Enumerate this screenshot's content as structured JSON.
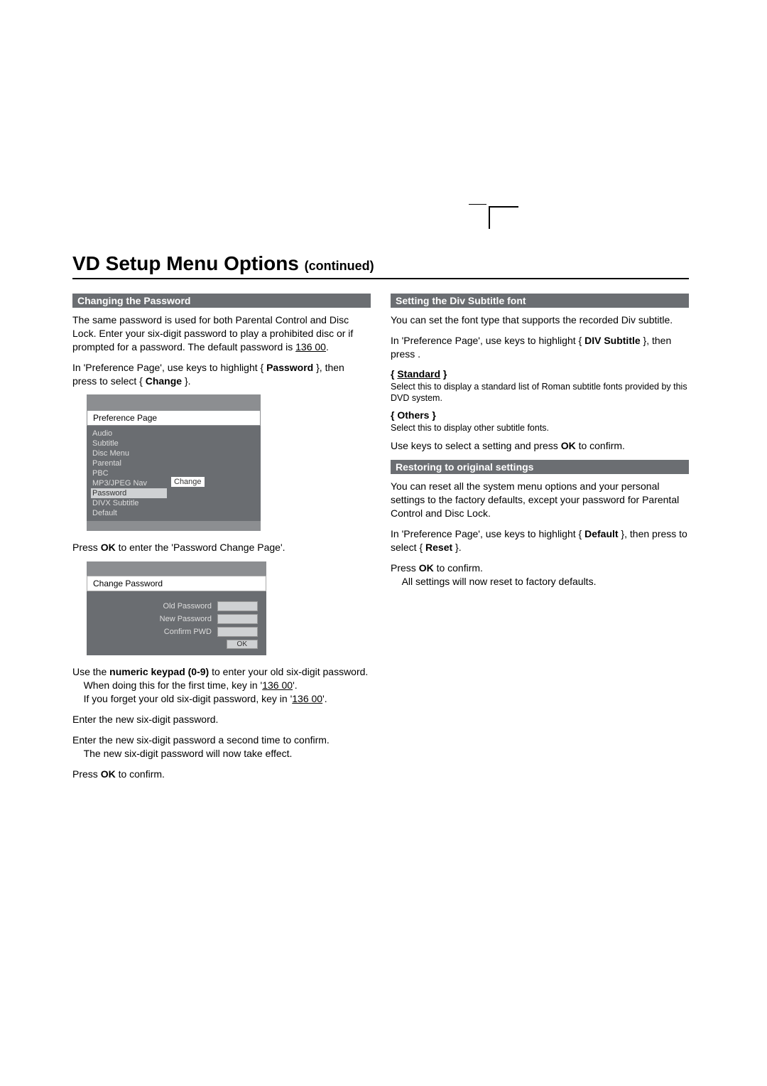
{
  "title": "VD Setup Menu Options",
  "title_suffix": "(continued)",
  "left": {
    "hdr1": "Changing the Password",
    "p1a": "The same password is used for both Parental Control and Disc Lock.  Enter your six-digit password to play a prohibited disc or if prompted for a password.  The default password is ",
    "default_pw": "136 00",
    "p1b": ".",
    "p2a": "In 'Preference Page', use ",
    "p2b": " keys to highlight { ",
    "p2c": "Password",
    "p2d": " }, then press      to select { ",
    "p2e": "Change",
    "p2f": " }.",
    "ui1": {
      "title": "Preference Page",
      "items": [
        "Audio",
        "Subtitle",
        "Disc Menu",
        "Parental",
        "PBC",
        "MP3/JPEG Nav",
        "Password",
        "DIVX Subtitle",
        "Default"
      ],
      "selected": "Password",
      "change": "Change"
    },
    "p3a": "Press ",
    "p3b": "OK",
    "p3c": " to enter the 'Password Change Page'.",
    "ui2": {
      "title": "Change Password",
      "rows": [
        "Old Password",
        "New Password",
        "Confirm PWD"
      ],
      "ok": "OK"
    },
    "p4a": "Use the ",
    "p4b": "numeric keypad (0-9)",
    "p4c": " to enter your old six-digit password.",
    "p4d": "When doing this for the first time, key in '",
    "p4e": "136 00",
    "p4f": "'.",
    "p4g": "If you forget your old six-digit password, key in '",
    "p4h": "136 00",
    "p4i": "'.",
    "p5": "Enter the new six-digit password.",
    "p6a": "Enter the new six-digit password a second time to confirm.",
    "p6b": "The new six-digit password will now take effect.",
    "p7a": "Press ",
    "p7b": "OK",
    "p7c": " to confirm."
  },
  "right": {
    "hdr1": "Setting the Div     Subtitle font",
    "p1": "You can set the font type that supports the recorded Div    subtitle.",
    "p2a": "In 'Preference Page', use ",
    "p2b": " keys to highlight { ",
    "p2c": "DIV    Subtitle",
    "p2d": " }, then press    .",
    "opt1": "Standard",
    "opt1d": "Select this to display a standard list of Roman subtitle fonts provided by this DVD system.",
    "opt2": "Others",
    "opt2d": "Select this to display other subtitle fonts.",
    "p3a": "Use ",
    "p3b": " keys to select a setting and press ",
    "p3c": "OK",
    "p3d": " to confirm.",
    "hdr2": "Restoring to original settings",
    "p4": "You can reset all the system menu options and your personal settings to the factory defaults, except your password for Parental Control and Disc Lock.",
    "p5a": "In 'Preference Page', use ",
    "p5b": " keys to highlight { ",
    "p5c": "Default",
    "p5d": " }, then press       to select { ",
    "p5e": "Reset",
    "p5f": " }.",
    "p6a": "Press ",
    "p6b": "OK",
    "p6c": " to confirm.",
    "p6d": "All settings will now reset to factory defaults."
  }
}
